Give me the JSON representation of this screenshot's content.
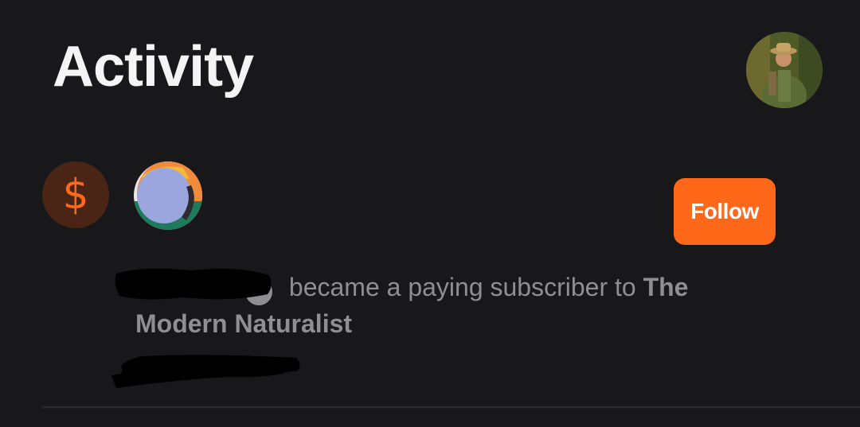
{
  "header": {
    "title": "Activity"
  },
  "activity_item": {
    "badge_icon": "dollar-icon",
    "badge_symbol": "$",
    "action_text": " became a paying subscriber to ",
    "publication_name": "The Modern Naturalist",
    "follow_label": "Follow"
  },
  "colors": {
    "background": "#18181b",
    "accent": "#ff6719",
    "muted_text": "#8e8e93"
  }
}
